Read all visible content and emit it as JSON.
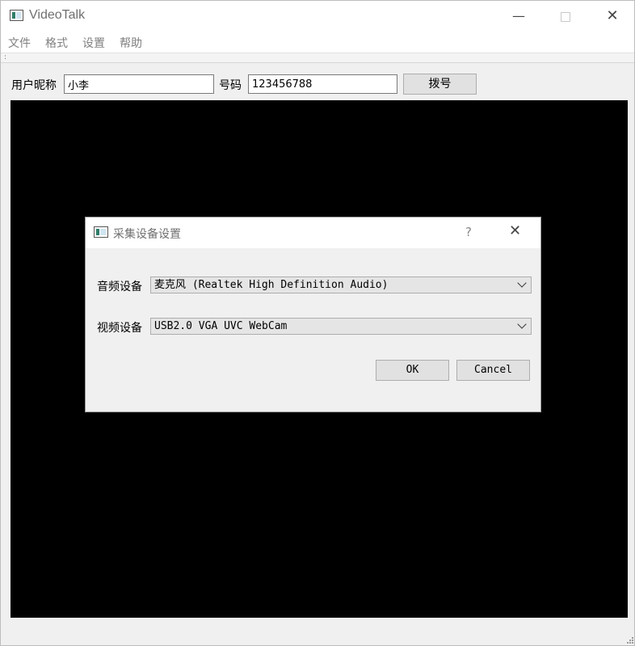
{
  "window": {
    "title": "VideoTalk",
    "minimize_glyph": "—",
    "close_glyph": "✕"
  },
  "menu": {
    "items": [
      "文件",
      "格式",
      "设置",
      "帮助"
    ]
  },
  "toolbar": {
    "grip_glyph": ":"
  },
  "form": {
    "nickname_label": "用户昵称",
    "nickname_value": "小李",
    "number_label": "号码",
    "number_value": "123456788",
    "dial_button": "拨号"
  },
  "dialog": {
    "title": "采集设备设置",
    "help_glyph": "?",
    "close_glyph": "✕",
    "audio_label": "音频设备",
    "audio_value": "麦克风 (Realtek High Definition Audio)",
    "video_label": "视频设备",
    "video_value": "USB2.0 VGA UVC WebCam",
    "ok_button": "OK",
    "cancel_button": "Cancel"
  },
  "icons": {
    "app": "app-window-icon",
    "dialog": "dialog-window-icon",
    "dropdown": "chevron-down-icon",
    "resize": "resize-grip-icon"
  }
}
